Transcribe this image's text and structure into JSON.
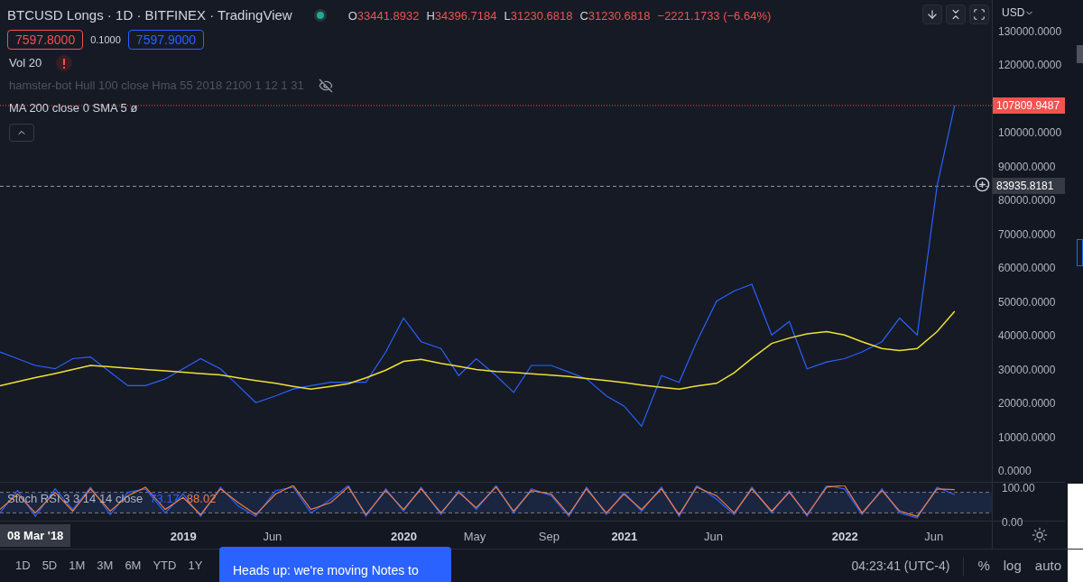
{
  "header": {
    "title": "BTCUSD Longs · 1D · BITFINEX · TradingView",
    "ohlc": [
      {
        "label": "O",
        "value": "33441.8932"
      },
      {
        "label": "H",
        "value": "34396.7184"
      },
      {
        "label": "L",
        "value": "31230.6818"
      },
      {
        "label": "C",
        "value": "31230.6818"
      }
    ],
    "change": "−2221.1733 (−6.64%)",
    "currency": "USD"
  },
  "trade": {
    "sell": "7597.8000",
    "spread": "0.1000",
    "buy": "7597.9000"
  },
  "indicators": [
    {
      "kind": "alert",
      "label": "Vol 20"
    },
    {
      "kind": "hidden",
      "label": "hamster-bot Hull 100 close Hma 55 2018 2100 1 12 1 31"
    },
    {
      "kind": "plain",
      "label": "MA 200 close 0 SMA 5  ø"
    }
  ],
  "price_chart": {
    "chart_data": {
      "type": "line",
      "x": [
        2018.17,
        2018.25,
        2018.33,
        2018.42,
        2018.5,
        2018.58,
        2018.67,
        2018.75,
        2018.83,
        2018.92,
        2019,
        2019.08,
        2019.17,
        2019.25,
        2019.33,
        2019.42,
        2019.5,
        2019.58,
        2019.67,
        2019.75,
        2019.83,
        2019.92,
        2020,
        2020.08,
        2020.17,
        2020.25,
        2020.33,
        2020.42,
        2020.5,
        2020.58,
        2020.67,
        2020.75,
        2020.83,
        2020.92,
        2021,
        2021.08,
        2021.17,
        2021.25,
        2021.33,
        2021.42,
        2021.5,
        2021.58,
        2021.67,
        2021.75,
        2021.83,
        2021.92,
        2022,
        2022.08,
        2022.17,
        2022.25,
        2022.33,
        2022.42,
        2022.5
      ],
      "series": [
        {
          "color": "#2962ff",
          "values": [
            35000,
            33000,
            31000,
            30000,
            33000,
            33500,
            29000,
            25000,
            25000,
            27000,
            30000,
            33000,
            30000,
            25000,
            20000,
            22000,
            24000,
            25000,
            26000,
            26000,
            26000,
            35000,
            45000,
            38000,
            36000,
            28000,
            33000,
            28000,
            23000,
            31000,
            31000,
            29000,
            27000,
            22000,
            19000,
            13000,
            28000,
            26000,
            38000,
            50000,
            53000,
            55000,
            40000,
            44000,
            30000,
            32000,
            33000,
            35000,
            38000,
            45000,
            40000,
            84000,
            107810
          ]
        },
        {
          "color": "#f0e130",
          "values": [
            25000,
            26200,
            27400,
            28600,
            29800,
            31000,
            30600,
            30200,
            29800,
            29400,
            29000,
            28600,
            28200,
            27300,
            26500,
            25700,
            24800,
            24000,
            24800,
            25600,
            27300,
            29600,
            32200,
            32800,
            31600,
            30700,
            29800,
            29200,
            28900,
            28500,
            28100,
            27700,
            27100,
            26500,
            25900,
            25200,
            24500,
            24000,
            24900,
            25700,
            28800,
            33100,
            37500,
            39100,
            40300,
            41000,
            40000,
            38000,
            36000,
            35400,
            36000,
            41000,
            47000
          ]
        }
      ],
      "xlim": [
        2018.17,
        2023
      ],
      "ylim": [
        -3684,
        139000
      ],
      "xticks": [
        {
          "value": 2019,
          "label": "2019"
        },
        {
          "value": 2019.42,
          "label": "Jun"
        },
        {
          "value": 2020,
          "label": "2020"
        },
        {
          "value": 2020.33,
          "label": "May"
        },
        {
          "value": 2020.67,
          "label": "Sep"
        },
        {
          "value": 2021,
          "label": "2021"
        },
        {
          "value": 2021.42,
          "label": "Jun"
        },
        {
          "value": 2022,
          "label": "2022"
        },
        {
          "value": 2022.42,
          "label": "Jun"
        }
      ],
      "yticks": [
        {
          "value": 130000,
          "label": "130000.0000"
        },
        {
          "value": 120000,
          "label": "120000.0000"
        },
        {
          "value": 100000,
          "label": "100000.0000"
        },
        {
          "value": 90000,
          "label": "90000.0000"
        },
        {
          "value": 80000,
          "label": "80000.0000"
        },
        {
          "value": 70000,
          "label": "70000.0000"
        },
        {
          "value": 60000,
          "label": "60000.0000"
        },
        {
          "value": 50000,
          "label": "50000.0000"
        },
        {
          "value": 40000,
          "label": "40000.0000"
        },
        {
          "value": 30000,
          "label": "30000.0000"
        },
        {
          "value": 20000,
          "label": "20000.0000"
        },
        {
          "value": 10000,
          "label": "10000.0000"
        },
        {
          "value": 0,
          "label": "0.0000"
        }
      ],
      "ref_lines": [
        {
          "axis": "y",
          "value": 107809.9487,
          "label": "107809.9487",
          "color": "#ef5350"
        },
        {
          "axis": "y",
          "value": 83935.8181,
          "label": "83935.8181",
          "color": "#9598a1"
        }
      ]
    }
  },
  "rsi": {
    "label": "Stoch RSI 3 3 14 14 close",
    "k": "73.17",
    "d": "88.02",
    "chart_data": {
      "type": "line",
      "x": [
        2018.17,
        2018.25,
        2018.33,
        2018.42,
        2018.5,
        2018.58,
        2018.67,
        2018.75,
        2018.83,
        2018.92,
        2019,
        2019.08,
        2019.17,
        2019.25,
        2019.33,
        2019.42,
        2019.5,
        2019.58,
        2019.67,
        2019.75,
        2019.83,
        2019.92,
        2020,
        2020.08,
        2020.17,
        2020.25,
        2020.33,
        2020.42,
        2020.5,
        2020.58,
        2020.67,
        2020.75,
        2020.83,
        2020.92,
        2021,
        2021.08,
        2021.17,
        2021.25,
        2021.33,
        2021.42,
        2021.5,
        2021.58,
        2021.67,
        2021.75,
        2021.83,
        2021.92,
        2022,
        2022.08,
        2022.17,
        2022.25,
        2022.33,
        2022.42,
        2022.5
      ],
      "series": [
        {
          "color": "#2962ff",
          "values": [
            20,
            85,
            10,
            90,
            30,
            95,
            15,
            80,
            90,
            20,
            75,
            10,
            95,
            40,
            10,
            85,
            95,
            20,
            60,
            100,
            10,
            90,
            25,
            95,
            15,
            85,
            30,
            100,
            20,
            90,
            70,
            10,
            95,
            15,
            80,
            25,
            95,
            10,
            100,
            60,
            15,
            95,
            20,
            85,
            10,
            100,
            90,
            15,
            90,
            20,
            5,
            95,
            73
          ]
        },
        {
          "color": "#f57c3a",
          "values": [
            30,
            75,
            20,
            80,
            25,
            90,
            25,
            70,
            95,
            30,
            65,
            15,
            90,
            50,
            15,
            75,
            100,
            30,
            50,
            95,
            15,
            85,
            30,
            90,
            20,
            80,
            35,
            95,
            25,
            85,
            75,
            15,
            90,
            20,
            75,
            30,
            90,
            15,
            95,
            70,
            20,
            90,
            25,
            80,
            15,
            95,
            100,
            20,
            85,
            25,
            10,
            90,
            88
          ]
        }
      ],
      "xlim": [
        2018.17,
        2023
      ],
      "ylim": [
        0,
        100
      ],
      "bands": [
        {
          "axis": "y",
          "from": 20,
          "to": 80,
          "color": "#1a2540"
        }
      ],
      "ref_lines": [
        {
          "axis": "y",
          "value": 80,
          "color": "#787b86"
        },
        {
          "axis": "y",
          "value": 20,
          "color": "#787b86"
        }
      ],
      "yticks": [
        {
          "value": 100,
          "label": "100.00"
        },
        {
          "value": 0,
          "label": "0.00"
        }
      ]
    }
  },
  "time_axis": {
    "cursor": "08 Mar '18"
  },
  "ranges": [
    "1D",
    "5D",
    "1M",
    "3M",
    "6M",
    "YTD",
    "1Y"
  ],
  "notice": "Heads up: we're moving Notes to",
  "clock": "04:23:41 (UTC-4)",
  "scale_buttons": [
    "%",
    "log",
    "auto"
  ]
}
